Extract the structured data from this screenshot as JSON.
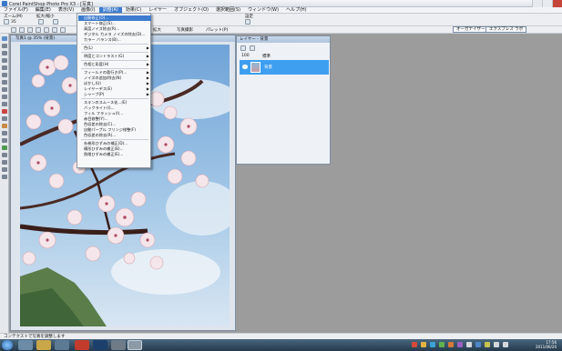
{
  "window": {
    "title": "Corel PaintShop Photo Pro X3 - [写真]"
  },
  "menubar": {
    "items": [
      "ファイル(F)",
      "編集(E)",
      "表示(V)",
      "画像(I)",
      "調整(A)",
      "効果(C)",
      "レイヤー",
      "オブジェクト(O)",
      "選択範囲(S)",
      "ウィンドウ(W)",
      "ヘルプ(H)"
    ]
  },
  "toolbar": {
    "tool_label": "ズーム(M)",
    "zoom_group": "拡大/縮小",
    "settings_label": "設定",
    "organizer_label": "オーガナイザー",
    "express_lab_label": "エクスプレス ラボ",
    "zoom_value": "35",
    "labels": [
      "拡大",
      "写真撮影",
      "パレット(P)"
    ]
  },
  "image_window": {
    "title": "写真1 @ 35% (背景)"
  },
  "layers_palette": {
    "title": "レイヤー - 背景",
    "mode": "標準",
    "opacity": "100",
    "layer_name": "背景"
  },
  "adjust_menu": {
    "items": [
      {
        "label": "自動修正(O)...",
        "highlight": true
      },
      {
        "label": "スマート修正(S)..."
      },
      {
        "label": "高度ノイズ除去(R)..."
      },
      {
        "label": "デジタル カメラ ノイズの除去(D)..."
      },
      {
        "label": "カラー バランス(B)..."
      },
      {
        "sep": true
      },
      {
        "label": "色(L)",
        "sub": true
      },
      {
        "sep": true
      },
      {
        "label": "明度とコントラスト(G)",
        "sub": true
      },
      {
        "sep": true
      },
      {
        "label": "色相と彩度(H)",
        "sub": true
      },
      {
        "sep": true
      },
      {
        "label": "フィールドの奥行き(P)...",
        "sub": true
      },
      {
        "label": "ノイズの追加/除去(N)",
        "sub": true
      },
      {
        "label": "ぼかし(U)",
        "sub": true
      },
      {
        "label": "レイヤーデス(E)",
        "sub": true
      },
      {
        "label": "シャープ(P)",
        "sub": true
      },
      {
        "sep": true
      },
      {
        "label": "スキンのスムース化...(E)"
      },
      {
        "label": "バックライト(I)..."
      },
      {
        "label": "フィル フラッシュ(I)..."
      },
      {
        "label": "赤目修整(Y)..."
      },
      {
        "label": "色収差の除去(C)..."
      },
      {
        "label": "自動パープル フリンジ修整(F)"
      },
      {
        "label": "色収差の除去(R)..."
      },
      {
        "sep": true
      },
      {
        "label": "糸巻形ひずみの補正(D)..."
      },
      {
        "label": "樽形ひずみの補正(B)..."
      },
      {
        "label": "魚眼ひずみの補正(E)..."
      }
    ]
  },
  "statusbar": {
    "text": "コンテクストで写真を調整します"
  },
  "taskbar": {
    "time": "17:56",
    "date": "2011/06/20"
  },
  "colors": {
    "accent": "#3d7ccf",
    "layer_selected": "#3e9ff0",
    "workspace": "#9c9c9c"
  }
}
